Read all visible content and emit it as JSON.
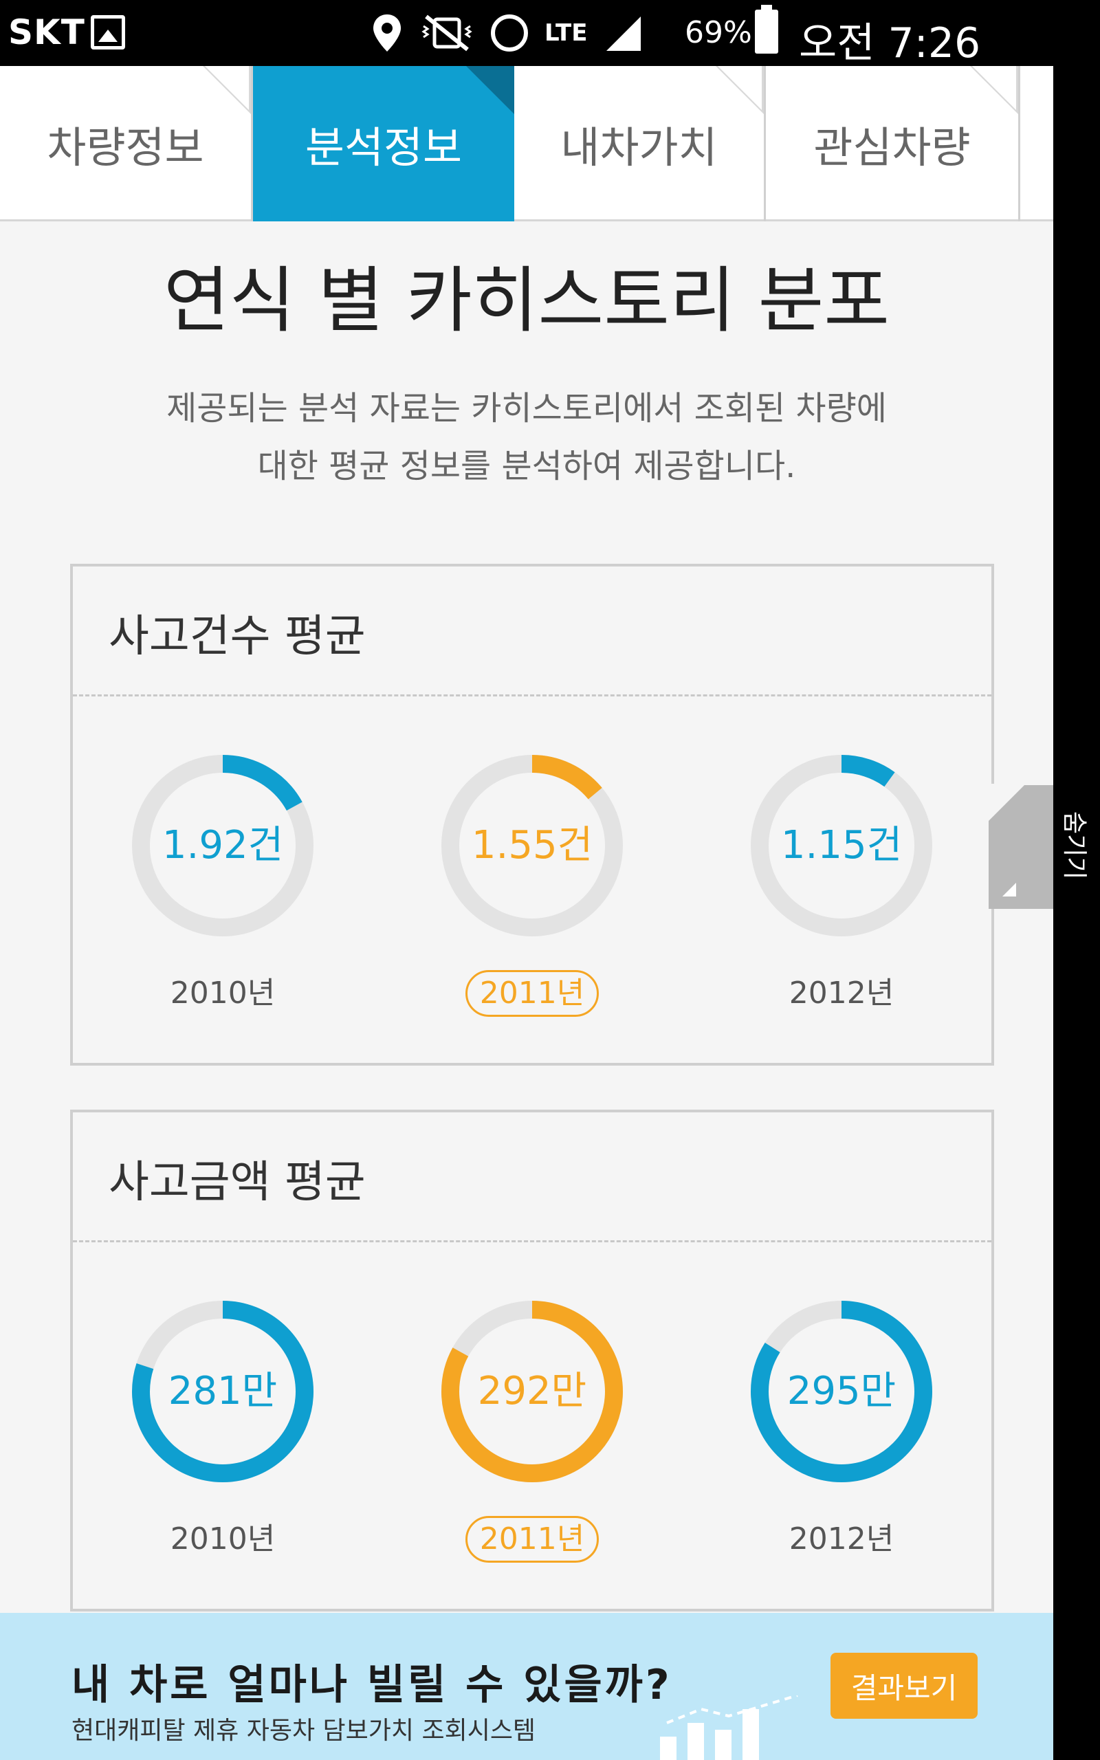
{
  "status_bar": {
    "carrier": "SKT",
    "lte": "LTE",
    "battery": "69%",
    "time": "오전 7:26"
  },
  "tabs": [
    {
      "label": "차량정보",
      "active": false
    },
    {
      "label": "분석정보",
      "active": true
    },
    {
      "label": "내차가치",
      "active": false
    },
    {
      "label": "관심차량",
      "active": false
    }
  ],
  "page": {
    "title": "연식 별 카히스토리 분포",
    "description_line1": "제공되는 분석 자료는 카히스토리에서 조회된 차량에",
    "description_line2": "대한 평균 정보를 분석하여 제공합니다."
  },
  "colors": {
    "accent_blue": "#0f9fd0",
    "accent_orange": "#f5a623",
    "ring_track": "#e3e3e3"
  },
  "cards": [
    {
      "title": "사고건수 평균",
      "items": [
        {
          "value": "1.92건",
          "year": "2010년",
          "fraction": 0.17,
          "color": "blue",
          "selected": false
        },
        {
          "value": "1.55건",
          "year": "2011년",
          "fraction": 0.14,
          "color": "orange",
          "selected": true
        },
        {
          "value": "1.15건",
          "year": "2012년",
          "fraction": 0.1,
          "color": "blue",
          "selected": false
        }
      ]
    },
    {
      "title": "사고금액 평균",
      "items": [
        {
          "value": "281만",
          "year": "2010년",
          "fraction": 0.8,
          "color": "blue",
          "selected": false
        },
        {
          "value": "292만",
          "year": "2011년",
          "fraction": 0.83,
          "color": "orange",
          "selected": true
        },
        {
          "value": "295만",
          "year": "2012년",
          "fraction": 0.84,
          "color": "blue",
          "selected": false
        }
      ]
    }
  ],
  "side_tab": {
    "label": "숨기기"
  },
  "banner": {
    "title": "내 차로 얼마나 빌릴 수 있을까?",
    "subtitle": "현대캐피탈 제휴 자동차 담보가치 조회시스템",
    "button": "결과보기"
  }
}
